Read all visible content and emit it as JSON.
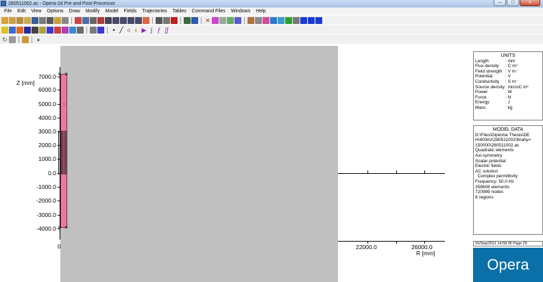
{
  "window": {
    "title": "280511002.ac - Opera-2d Pre and Post-Processor",
    "minimize": "–",
    "maximize": "□",
    "close": "x"
  },
  "menu": [
    "File",
    "Edit",
    "View",
    "Options",
    "Draw",
    "Modify",
    "Model",
    "Fields",
    "Trajectories",
    "Tables",
    "Command Files",
    "Windows",
    "Help"
  ],
  "plot": {
    "y_axis_name": "Z [mm]",
    "y_ticks": [
      "7000.0",
      "6000.0",
      "5000.0",
      "4000.0",
      "3000.0",
      "2000.0",
      "1000.0",
      "0.0",
      "-1000.0",
      "-2000.0",
      "-3000.0",
      "-4000.0"
    ],
    "x_origin": "0",
    "x_ticks": [
      "22000.0",
      "26000.0"
    ],
    "x_axis_name": "R [mm]",
    "region_label": "7",
    "marker": "×",
    "colors": {
      "plot_bg": "#c0c0c0",
      "region": "#e87aa0"
    }
  },
  "units": {
    "title": "UNITS",
    "rows": [
      {
        "name": "Length",
        "unit": ": mm"
      },
      {
        "name": "Flux density",
        "unit": ": C m²"
      },
      {
        "name": "Field strength",
        "unit": ": V m⁻"
      },
      {
        "name": "Potential",
        "unit": ": V"
      },
      {
        "name": "Conductivity",
        "unit": ": S m⁻"
      },
      {
        "name": "Source density",
        "unit": ": microC m³"
      },
      {
        "name": "Power",
        "unit": ": W"
      },
      {
        "name": "Force",
        "unit": ": N"
      },
      {
        "name": "Energy",
        "unit": ": J"
      },
      {
        "name": "Mass",
        "unit": ": kg"
      }
    ]
  },
  "model_data": {
    "title": "MODEL DATA",
    "lines": [
      "D:\\Files\\Diploma Thesis\\DE",
      "H\\400kV\\280511002\\final\\y=",
      "150000\\280511002.ac",
      "Quadratic elements",
      "Axi-symmetry",
      "Scalar potential",
      "Electric fields",
      "AC solution",
      "  Complex permittivity",
      "Frequency: 50.0 Hz",
      "358608 elements",
      "720989 nodes",
      "8 regions"
    ]
  },
  "footer": {
    "date": "16/Sep/2011 14:58:35 Page 29",
    "logo": "Opera",
    "logo_color": "#0b6fa8"
  }
}
